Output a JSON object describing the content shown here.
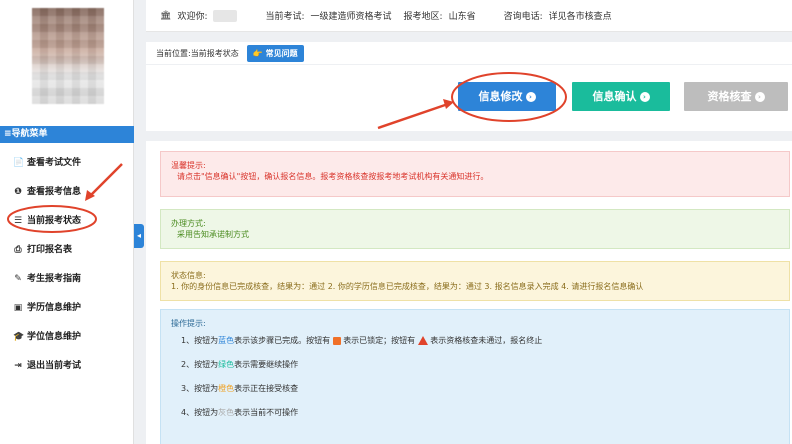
{
  "topbar": {
    "welcome_label": "欢迎你:",
    "exam_label": "当前考试:",
    "exam_value": "一级建造师资格考试",
    "region_label": "报考地区:",
    "region_value": "山东省",
    "phone_label": "咨询电话:",
    "phone_value": "详见各市核查点"
  },
  "breadcrumb": {
    "label": "当前位置:",
    "current": "当前报考状态",
    "faq_button": "常见问题"
  },
  "actions": {
    "edit": "信息修改",
    "confirm": "信息确认",
    "check": "资格核查"
  },
  "sidebar": {
    "header": "≡导航菜单",
    "items": [
      {
        "label": "查看考试文件",
        "icon": "📄"
      },
      {
        "label": "查看报考信息",
        "icon": "❶"
      },
      {
        "label": "当前报考状态",
        "icon": "☰"
      },
      {
        "label": "打印报名表",
        "icon": "⎙"
      },
      {
        "label": "考生报考指南",
        "icon": "✎"
      },
      {
        "label": "学历信息维护",
        "icon": "▣"
      },
      {
        "label": "学位信息维护",
        "icon": "🎓"
      },
      {
        "label": "退出当前考试",
        "icon": "⇥"
      }
    ]
  },
  "notices": {
    "warm_title": "温馨提示:",
    "warm_text": "请点击\"信息确认\"按钮，确认报名信息。报考资格核查按报考地考试机构有关通知进行。",
    "method_title": "办理方式:",
    "method_text": "采用告知承诺制方式",
    "status_title": "状态信息:",
    "status_text": "1. 你的身份信息已完成核查，结果为：通过 2. 你的学历信息已完成核查，结果为：通过 3. 报名信息录入完成 4. 请进行报名信息确认",
    "ops_title": "操作提示:",
    "ops_1a": "1、按钮为",
    "ops_1_blue": "蓝色",
    "ops_1b": "表示该步骤已完成。按钮有",
    "ops_1c": "表示已锁定；按钮有",
    "ops_1d": "表示资格核查未通过，报名终止",
    "ops_2a": "2、按钮为",
    "ops_2_green": "绿色",
    "ops_2b": "表示需要继续操作",
    "ops_3a": "3、按钮为",
    "ops_3_orange": "橙色",
    "ops_3b": "表示正在接受核查",
    "ops_4a": "4、按钮为",
    "ops_4_gray": "灰色",
    "ops_4b": "表示当前不可操作"
  },
  "colors": {
    "primary": "#2d84d8",
    "green": "#1abc9c",
    "gray": "#bdbdbd",
    "annotation": "#e0432b"
  }
}
